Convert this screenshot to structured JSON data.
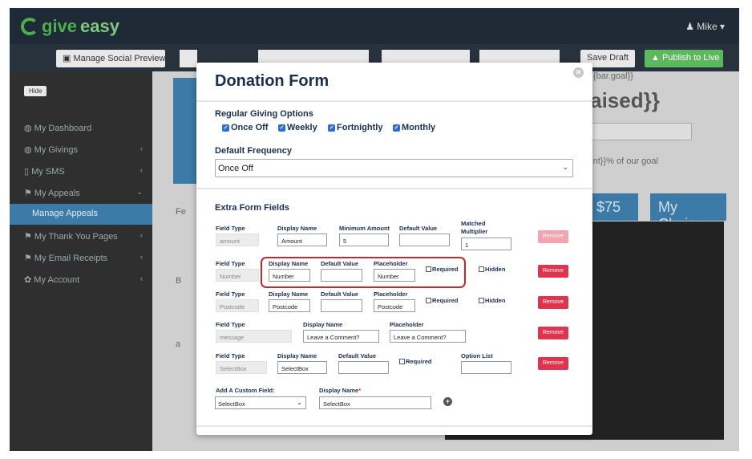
{
  "app": {
    "logo_give": "give",
    "logo_easy": "easy",
    "user_menu": "Mike ▾"
  },
  "toolbar": {
    "social_preview": "Manage Social Preview",
    "save_draft": "Save Draft",
    "publish": "Publish to Live"
  },
  "sidebar": {
    "hide_label": "Hide",
    "items": [
      {
        "label": "My Dashboard",
        "chevron": ""
      },
      {
        "label": "My Givings",
        "chevron": "‹"
      },
      {
        "label": "My SMS",
        "chevron": "‹"
      },
      {
        "label": "My Appeals",
        "chevron": "⌄"
      },
      {
        "label": "Manage Appeals",
        "chevron": ""
      },
      {
        "label": "My Thank You Pages",
        "chevron": "‹"
      },
      {
        "label": "My Email Receipts",
        "chevron": "‹"
      },
      {
        "label": "My Account",
        "chevron": "‹"
      }
    ]
  },
  "background": {
    "goal_text": "${{bar.goal}}",
    "raised_text": "raised}}",
    "percent_text": "cent}}% of our goal",
    "amount_75": "$75",
    "my_choice": "My Choice",
    "partial_fe": "Fe",
    "partial_b": "B",
    "partial_a": "a"
  },
  "modal": {
    "title": "Donation Form",
    "close_icon": "close-icon",
    "regular_giving": {
      "title": "Regular Giving Options",
      "options": [
        {
          "label": "Once Off",
          "checked": true
        },
        {
          "label": "Weekly",
          "checked": true
        },
        {
          "label": "Fortnightly",
          "checked": true
        },
        {
          "label": "Monthly",
          "checked": true
        }
      ]
    },
    "default_frequency": {
      "title": "Default Frequency",
      "value": "Once Off"
    },
    "extra_fields": {
      "title": "Extra Form Fields",
      "amount_row": {
        "field_type_label": "Field Type",
        "field_type_value": "amount",
        "display_name_label": "Display Name",
        "display_name_value": "Amount",
        "min_amount_label": "Minimum Amount",
        "min_amount_value": "5",
        "default_value_label": "Default Value",
        "default_value_value": "",
        "matched_label_1": "Matched",
        "matched_label_2": "Multiplier",
        "matched_value": "1",
        "remove": "Remove"
      },
      "number_row": {
        "field_type_label": "Field Type",
        "field_type_value": "Number",
        "display_name_label": "Display Name",
        "display_name_value": "Number",
        "default_value_label": "Default Value",
        "default_value_value": "",
        "placeholder_label": "Placeholder",
        "placeholder_value": "Number",
        "required_label": "Required",
        "hidden_label": "Hidden",
        "remove": "Remove"
      },
      "postcode_row": {
        "field_type_label": "Field Type",
        "field_type_value": "Postcode",
        "display_name_label": "Display Name",
        "display_name_value": "Postcode",
        "default_value_label": "Default Value",
        "default_value_value": "",
        "placeholder_label": "Placeholder",
        "placeholder_value": "Postcode",
        "required_label": "Required",
        "hidden_label": "Hidden",
        "remove": "Remove"
      },
      "message_row": {
        "field_type_label": "Field Type",
        "field_type_value": "message",
        "display_name_label": "Display Name",
        "display_name_value": "Leave a Comment?",
        "placeholder_label": "Placeholder",
        "placeholder_value": "Leave a Comment?",
        "remove": "Remove"
      },
      "selectbox_row": {
        "field_type_label": "Field Type",
        "field_type_value": "SelectBox",
        "display_name_label": "Display Name",
        "display_name_value": "SelectBox",
        "default_value_label": "Default Value",
        "default_value_value": "",
        "required_label": "Required",
        "option_list_label": "Option List",
        "option_list_value": "",
        "remove": "Remove"
      },
      "add_custom": {
        "label": "Add A Custom Field:",
        "select_value": "SelectBox",
        "display_name_label": "Display Name",
        "required_mark": "*",
        "display_name_value": "SelectBox"
      }
    }
  }
}
